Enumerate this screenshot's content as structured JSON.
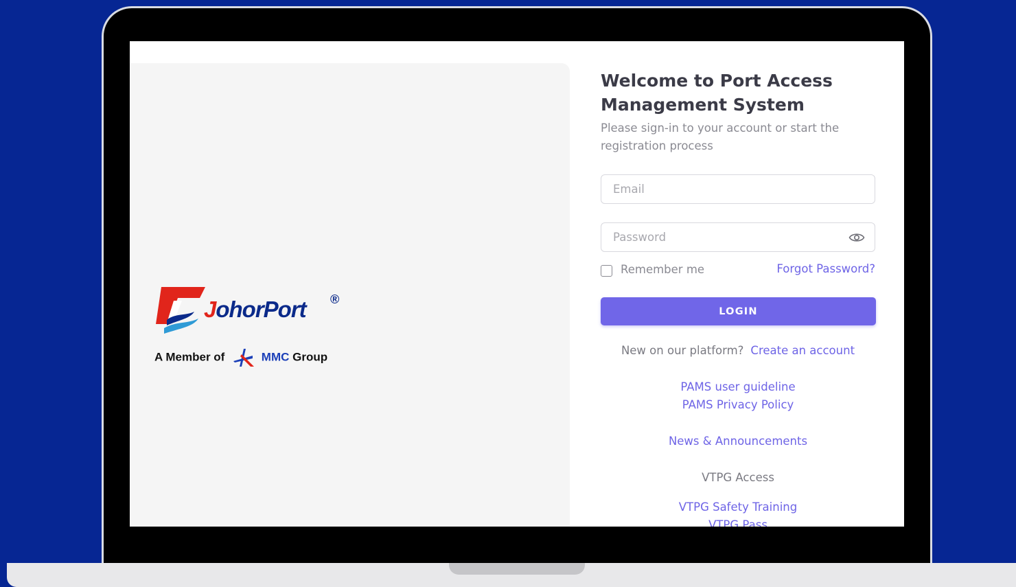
{
  "brand": {
    "logo_name": "JohorPort",
    "logo_first_letter": "J",
    "logo_rest": "ohorPort",
    "registered_mark": "®",
    "member_prefix": "A Member of",
    "group_name": "MMC",
    "group_suffix": "Group"
  },
  "header": {
    "title": "Welcome to Port Access Management System",
    "subtitle": "Please sign-in to your account or start the registration process"
  },
  "form": {
    "email_placeholder": "Email",
    "password_placeholder": "Password",
    "remember_label": "Remember me",
    "forgot_label": "Forgot Password?",
    "login_label": "LOGIN"
  },
  "signup": {
    "prompt": "New on our platform?",
    "link_label": "Create an account"
  },
  "links": {
    "guideline": "PAMS user guideline",
    "privacy": "PAMS Privacy Policy",
    "news": "News & Announcements",
    "vtpg_heading": "VTPG Access",
    "vtpg_training": "VTPG Safety Training",
    "vtpg_pass": "VTPG Pass"
  },
  "colors": {
    "background": "#062693",
    "accent": "#7066e8",
    "link": "#6e64e6",
    "logo_red": "#e1251b",
    "logo_blue": "#0b2a8a"
  },
  "icons": {
    "password_toggle": "eye-icon",
    "remember": "checkbox-icon"
  }
}
